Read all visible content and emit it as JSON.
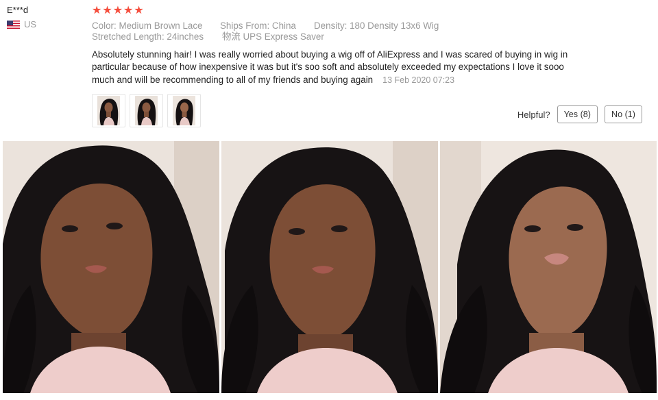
{
  "review": {
    "reviewer_name": "E***d",
    "country": "US",
    "rating": 5,
    "stars": [
      "★",
      "★",
      "★",
      "★",
      "★"
    ],
    "star_color": "#f54e3d",
    "attributes": {
      "color": "Color: Medium Brown Lace",
      "ships_from": "Ships From: China",
      "density": "Density: 180 Density 13x6 Wig",
      "stretched_length": "Stretched Length: 24inches",
      "shipping": "物流 UPS Express Saver"
    },
    "text": "Absolutely stunning hair! I was really worried about buying a wig off of AliExpress and I was scared of buying in wig in particular because of how inexpensive it was but it's soo soft and absolutely exceeded my expectations I love it sooo much and will be recommending to all of my friends and buying again",
    "date": "13 Feb 2020 07:23",
    "helpful": {
      "label": "Helpful?",
      "yes": "Yes (8)",
      "no": "No (1)"
    }
  },
  "icons": {
    "flag": "us-flag-icon",
    "star": "star-icon"
  }
}
